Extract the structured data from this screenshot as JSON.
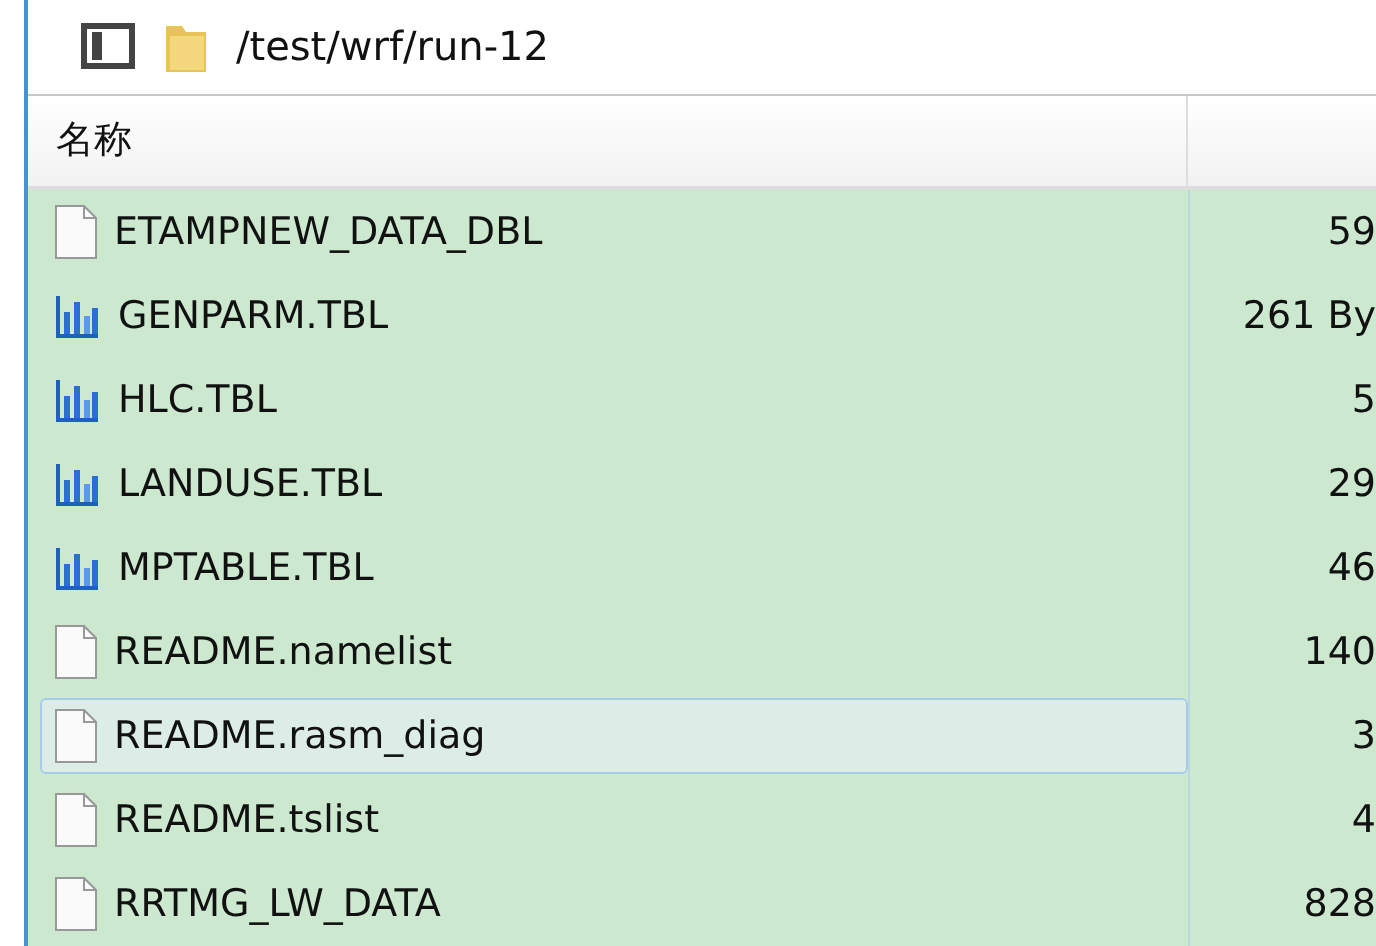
{
  "toolbar": {
    "path": "/test/wrf/run-12"
  },
  "table": {
    "columns": [
      "名称"
    ],
    "rows": [
      {
        "name": "ETAMPNEW_DATA_DBL",
        "size": "59",
        "kind": "file",
        "selected": false
      },
      {
        "name": "GENPARM.TBL",
        "size": "261 By",
        "kind": "table",
        "selected": false
      },
      {
        "name": "HLC.TBL",
        "size": "5",
        "kind": "table",
        "selected": false
      },
      {
        "name": "LANDUSE.TBL",
        "size": "29",
        "kind": "table",
        "selected": false
      },
      {
        "name": "MPTABLE.TBL",
        "size": "46",
        "kind": "table",
        "selected": false
      },
      {
        "name": "README.namelist",
        "size": "140",
        "kind": "file",
        "selected": false
      },
      {
        "name": "README.rasm_diag",
        "size": "3",
        "kind": "file",
        "selected": true
      },
      {
        "name": "README.tslist",
        "size": "4",
        "kind": "file",
        "selected": false
      },
      {
        "name": "RRTMG_LW_DATA",
        "size": "828",
        "kind": "file",
        "selected": false
      }
    ]
  }
}
